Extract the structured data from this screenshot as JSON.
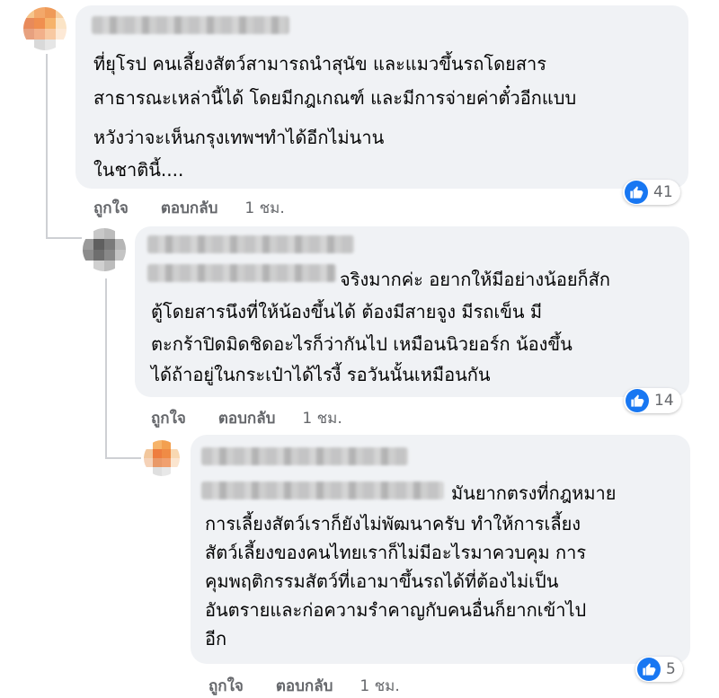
{
  "colors": {
    "like_blue": "#1877f2",
    "bubble": "#f0f2f5",
    "action_gray": "#65676b"
  },
  "comments": [
    {
      "lines": [
        "ที่ยุโรป คนเลี้ยงสัตว์สามารถนำสุนัข และแมวขึ้นรถโดยสาร",
        "สาธารณะเหล่านี้ได้ โดยมีกฎเกณฑ์ และมีการจ่ายค่าตั๋วอีกแบบ",
        "หวังว่าจะเห็นกรุงเทพฯทำได้อีกไม่นาน",
        "ในชาตินี้...."
      ],
      "like_label": "ถูกใจ",
      "reply_label": "ตอบกลับ",
      "time": "1 ชม.",
      "reaction_icon": "like-icon",
      "reaction_count": "41"
    },
    {
      "lines": [
        "จริงมากค่ะ อยากให้มีอย่างน้อยก็สัก",
        "ตู้โดยสารนึงที่ให้น้องขึ้นได้ ต้องมีสายจูง มีรถเข็น มี",
        "ตะกร้าปิดมิดชิดอะไรก็ว่ากันไป เหมือนนิวยอร์ก น้องขึ้น",
        "ได้ถ้าอยู่ในกระเป๋าได้ไรงี้ รอวันนั้นเหมือนกัน"
      ],
      "like_label": "ถูกใจ",
      "reply_label": "ตอบกลับ",
      "time": "1 ชม.",
      "reaction_icon": "like-icon",
      "reaction_count": "14"
    },
    {
      "lines": [
        "มันยากตรงที่กฎหมาย",
        "การเลี้ยงสัตว์เราก็ยังไม่พัฒนาครับ ทำให้การเลี้ยง",
        "สัตว์เลี้ยงของคนไทยเราก็ไม่มีอะไรมาควบคุม การ",
        "คุมพฤติกรรมสัตว์ที่เอามาขึ้นรถได้ที่ต้องไม่เป็น",
        "อันตรายและก่อความรำคาญกับคนอื่นก็ยากเข้าไป",
        "อีก"
      ],
      "like_label": "ถูกใจ",
      "reply_label": "ตอบกลับ",
      "time": "1 ชม.",
      "reaction_icon": "like-icon",
      "reaction_count": "5"
    }
  ]
}
